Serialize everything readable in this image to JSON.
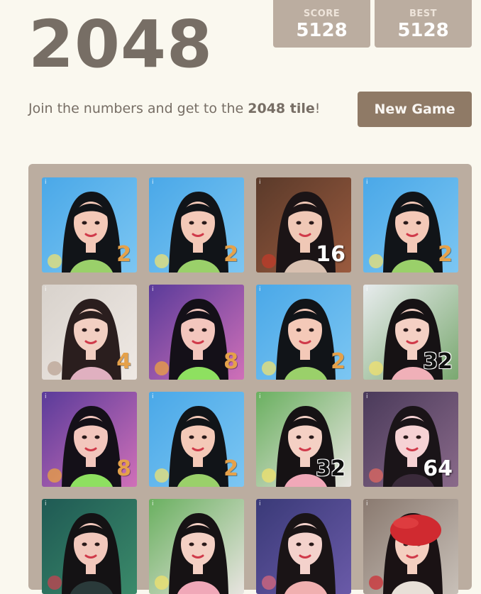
{
  "header": {
    "title": "2048",
    "score_label": "SCORE",
    "score_value": "5128",
    "best_label": "BEST",
    "best_value": "5128"
  },
  "intro": {
    "text_before": "Join the numbers and get to the ",
    "text_bold": "2048 tile",
    "text_after": "!"
  },
  "new_game_label": "New Game",
  "colors": {
    "background": "#faf8ef",
    "board": "#bbada0",
    "button": "#8f7a66",
    "text": "#776e65",
    "tile_number_low": "#e5a14a"
  },
  "board": {
    "rows": [
      [
        {
          "value": "2",
          "style": "gold",
          "bg": "sky"
        },
        {
          "value": "2",
          "style": "gold",
          "bg": "sky"
        },
        {
          "value": "16",
          "style": "white",
          "bg": "stage-brown"
        },
        {
          "value": "2",
          "style": "gold",
          "bg": "sky"
        }
      ],
      [
        {
          "value": "4",
          "style": "gold",
          "bg": "room-pale"
        },
        {
          "value": "8",
          "style": "gold",
          "bg": "stage-purple"
        },
        {
          "value": "2",
          "style": "gold",
          "bg": "sky"
        },
        {
          "value": "32",
          "style": "black",
          "bg": "outdoor-white"
        }
      ],
      [
        {
          "value": "8",
          "style": "gold",
          "bg": "stage-purple"
        },
        {
          "value": "2",
          "style": "gold",
          "bg": "sky"
        },
        {
          "value": "32",
          "style": "black",
          "bg": "outdoor-green"
        },
        {
          "value": "64",
          "style": "white",
          "bg": "portrait-pink"
        }
      ],
      [
        {
          "value": "",
          "style": "gold",
          "bg": "teal-dark"
        },
        {
          "value": "",
          "style": "gold",
          "bg": "outdoor-green"
        },
        {
          "value": "",
          "style": "gold",
          "bg": "portrait-indigo"
        },
        {
          "value": "",
          "style": "gold",
          "bg": "street-red"
        }
      ]
    ]
  }
}
